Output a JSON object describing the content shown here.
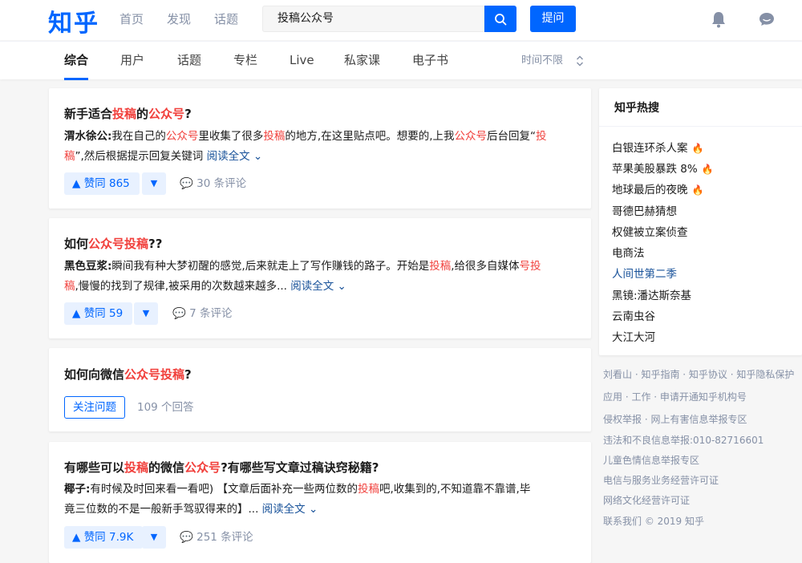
{
  "header": {
    "logo": "知乎",
    "nav": [
      "首页",
      "发现",
      "话题"
    ],
    "search_value": "投稿公众号",
    "ask_label": "提问"
  },
  "subnav": {
    "tabs": [
      "综合",
      "用户",
      "话题",
      "专栏",
      "Live",
      "私家课",
      "电子书"
    ],
    "time_filter": "时间不限"
  },
  "results": [
    {
      "title": [
        "新手适合",
        "投稿",
        "的",
        "公众号",
        "?"
      ],
      "author": "渭水徐公:",
      "excerpt_l1": [
        "我在自己的",
        "公众号",
        "里收集了很多",
        "投稿",
        "的地方,在这里贴点吧。想要的,上我",
        "公众号",
        "后台回复“",
        "投"
      ],
      "excerpt_l2": [
        "稿",
        "”,然后根据提示回复关键词 "
      ],
      "read_more": "阅读全文",
      "votes": "赞同 865",
      "comments": "30 条评论"
    },
    {
      "title": [
        "如何",
        "公众号投稿",
        "??"
      ],
      "author": "黑色豆浆:",
      "excerpt_l1": [
        "瞬间我有种大梦初醒的感觉,后来就走上了写作赚钱的路子。开始是",
        "投稿",
        ",给很多自媒体",
        "号投"
      ],
      "excerpt_l2": [
        "稿",
        ",慢慢的找到了规律,被采用的次数越来越多... "
      ],
      "read_more": "阅读全文",
      "votes": "赞同 59",
      "comments": "7 条评论"
    },
    {
      "title": [
        "如何向微信",
        "公众号投稿",
        "?"
      ],
      "follow_label": "关注问题",
      "answers": "109 个回答"
    },
    {
      "title": [
        "有哪些可以",
        "投稿",
        "的微信",
        "公众号",
        "?有哪些写文章过稿诀窍秘籍?"
      ],
      "author": "椰子:",
      "excerpt_l1": [
        "有时候及时回来看一看吧) 【文章后面补充一些两位数的",
        "投稿",
        "吧,收集到的,不知道靠不靠谱,毕"
      ],
      "excerpt_l2": [
        "竟三位数的不是一般新手驾驭得来的】... "
      ],
      "read_more": "阅读全文",
      "votes": "赞同 7.9K",
      "comments": "251 条评论"
    }
  ],
  "sidebar": {
    "title": "知乎热搜",
    "items": [
      {
        "label": "白银连环杀人案",
        "hot": true
      },
      {
        "label": "苹果美股暴跌 8%",
        "hot": true
      },
      {
        "label": "地球最后的夜晚",
        "hot": true
      },
      {
        "label": "哥德巴赫猜想",
        "hot": false
      },
      {
        "label": "权健被立案侦查",
        "hot": false
      },
      {
        "label": "电商法",
        "hot": false
      },
      {
        "label": "人间世第二季",
        "hot": false
      },
      {
        "label": "黑镜:潘达斯奈基",
        "hot": false
      },
      {
        "label": "云南虫谷",
        "hot": false
      },
      {
        "label": "大江大河",
        "hot": false
      }
    ]
  },
  "footer": [
    "刘看山 · 知乎指南 · 知乎协议 · 知乎隐私保护",
    "应用 · 工作 · 申请开通知乎机构号",
    "侵权举报 · 网上有害信息举报专区",
    "违法和不良信息举报:010-82716601",
    "儿童色情信息举报专区",
    "电信与服务业务经营许可证",
    "网络文化经营许可证",
    "联系我们 © 2019 知乎"
  ],
  "colors": {
    "brand": "#0066ff",
    "highlight": "#f1403c",
    "link": "#175199",
    "muted": "#8590a6"
  }
}
